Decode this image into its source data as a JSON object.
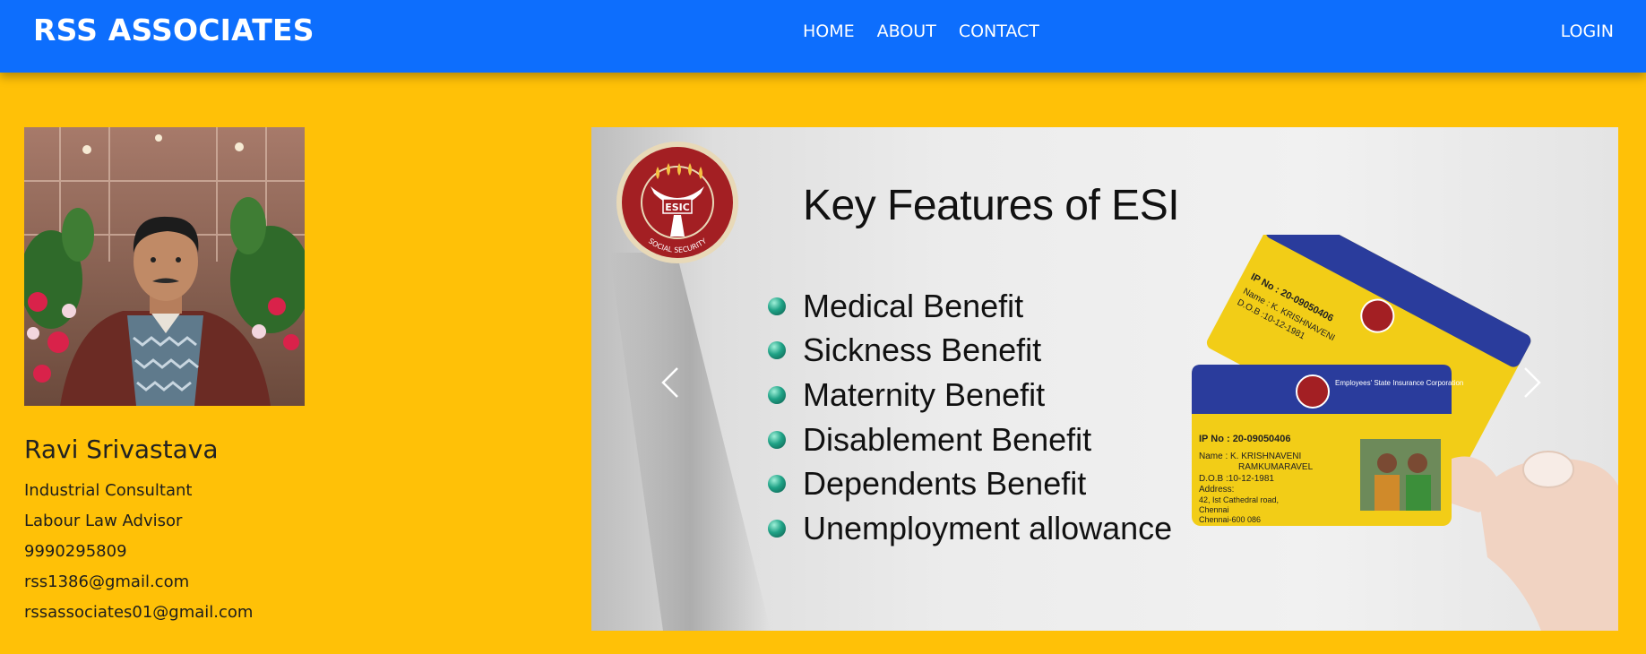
{
  "navbar": {
    "brand": "RSS ASSOCIATES",
    "links": [
      "HOME",
      "ABOUT",
      "CONTACT"
    ],
    "login": "LOGIN",
    "bg_color": "#0d6efd"
  },
  "hero": {
    "bg_color": "#ffc107"
  },
  "profile": {
    "name": "Ravi Srivastava",
    "lines": [
      "Industrial Consultant",
      "Labour Law Advisor",
      "9990295809",
      "rss1386@gmail.com",
      "rssassociates01@gmail.com"
    ]
  },
  "carousel": {
    "logo_text": "ESIC",
    "logo_ring_text": "SOCIAL SECURITY",
    "title": "Key Features of ESI",
    "features": [
      "Medical Benefit",
      "Sickness Benefit",
      "Maternity Benefit",
      "Disablement Benefit",
      "Dependents Benefit",
      "Unemployment allowance"
    ],
    "card": {
      "ip_no": "IP No : 20-09050406",
      "name_line": "Name : K. KRISHNAVENI",
      "name_line2": "RAMKUMARAVEL",
      "dob": "D.O.B :10-12-1981",
      "address_label": "Address:",
      "address_1": "42, Ist Cathedral road,",
      "address_2": "Chennai",
      "address_3": "Chennai-600 086",
      "org": "Employees' State Insurance Corporation"
    },
    "prev_icon": "chevron-left-icon",
    "next_icon": "chevron-right-icon"
  }
}
